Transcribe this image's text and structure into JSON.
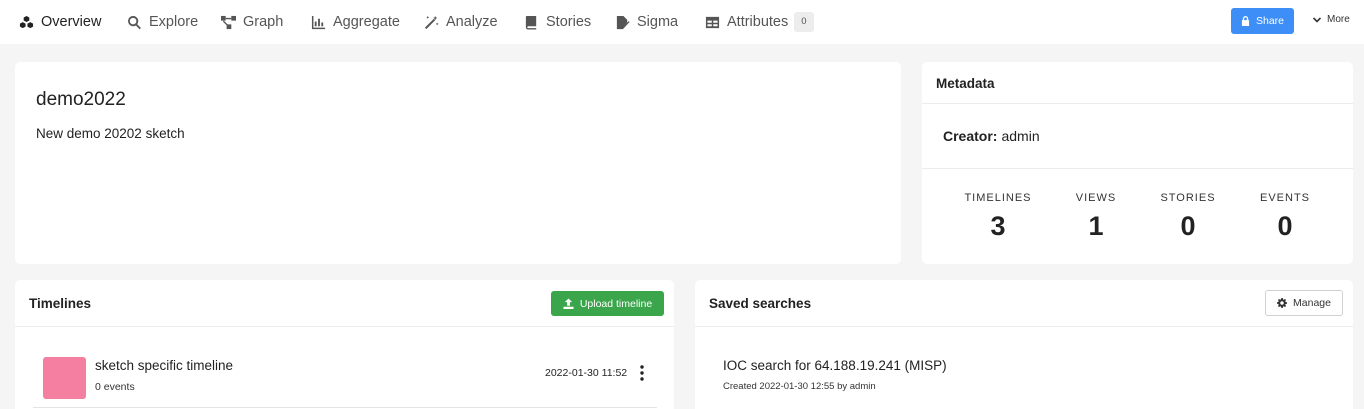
{
  "nav": {
    "tabs": [
      {
        "label": "Overview",
        "icon": "cubes-icon"
      },
      {
        "label": "Explore",
        "icon": "search-icon"
      },
      {
        "label": "Graph",
        "icon": "graph-icon"
      },
      {
        "label": "Aggregate",
        "icon": "bar-chart-icon"
      },
      {
        "label": "Analyze",
        "icon": "magic-wand-icon"
      },
      {
        "label": "Stories",
        "icon": "book-icon"
      },
      {
        "label": "Sigma",
        "icon": "signature-icon"
      },
      {
        "label": "Attributes",
        "icon": "table-icon",
        "badge": "0"
      }
    ],
    "active_tab": "Overview",
    "share_label": "Share",
    "more_label": "More"
  },
  "sketch": {
    "title": "demo2022",
    "description": "New demo 20202 sketch"
  },
  "metadata": {
    "title": "Metadata",
    "creator_label": "Creator:",
    "creator_value": "admin",
    "stats": [
      {
        "label": "TIMELINES",
        "value": "3"
      },
      {
        "label": "VIEWS",
        "value": "1"
      },
      {
        "label": "STORIES",
        "value": "0"
      },
      {
        "label": "EVENTS",
        "value": "0"
      }
    ]
  },
  "timelines": {
    "title": "Timelines",
    "upload_label": "Upload timeline",
    "items": [
      {
        "name": "sketch specific timeline",
        "events": "0 events",
        "date": "2022-01-30 11:52",
        "color": "#f47fa0"
      }
    ]
  },
  "saved_searches": {
    "title": "Saved searches",
    "manage_label": "Manage",
    "items": [
      {
        "name": "IOC search for 64.188.19.241 (MISP)",
        "meta": "Created 2022-01-30 12:55 by admin"
      }
    ]
  },
  "colors": {
    "share": "#3e8ef7",
    "upload": "#3aa54a",
    "background": "#f5f5f5"
  }
}
